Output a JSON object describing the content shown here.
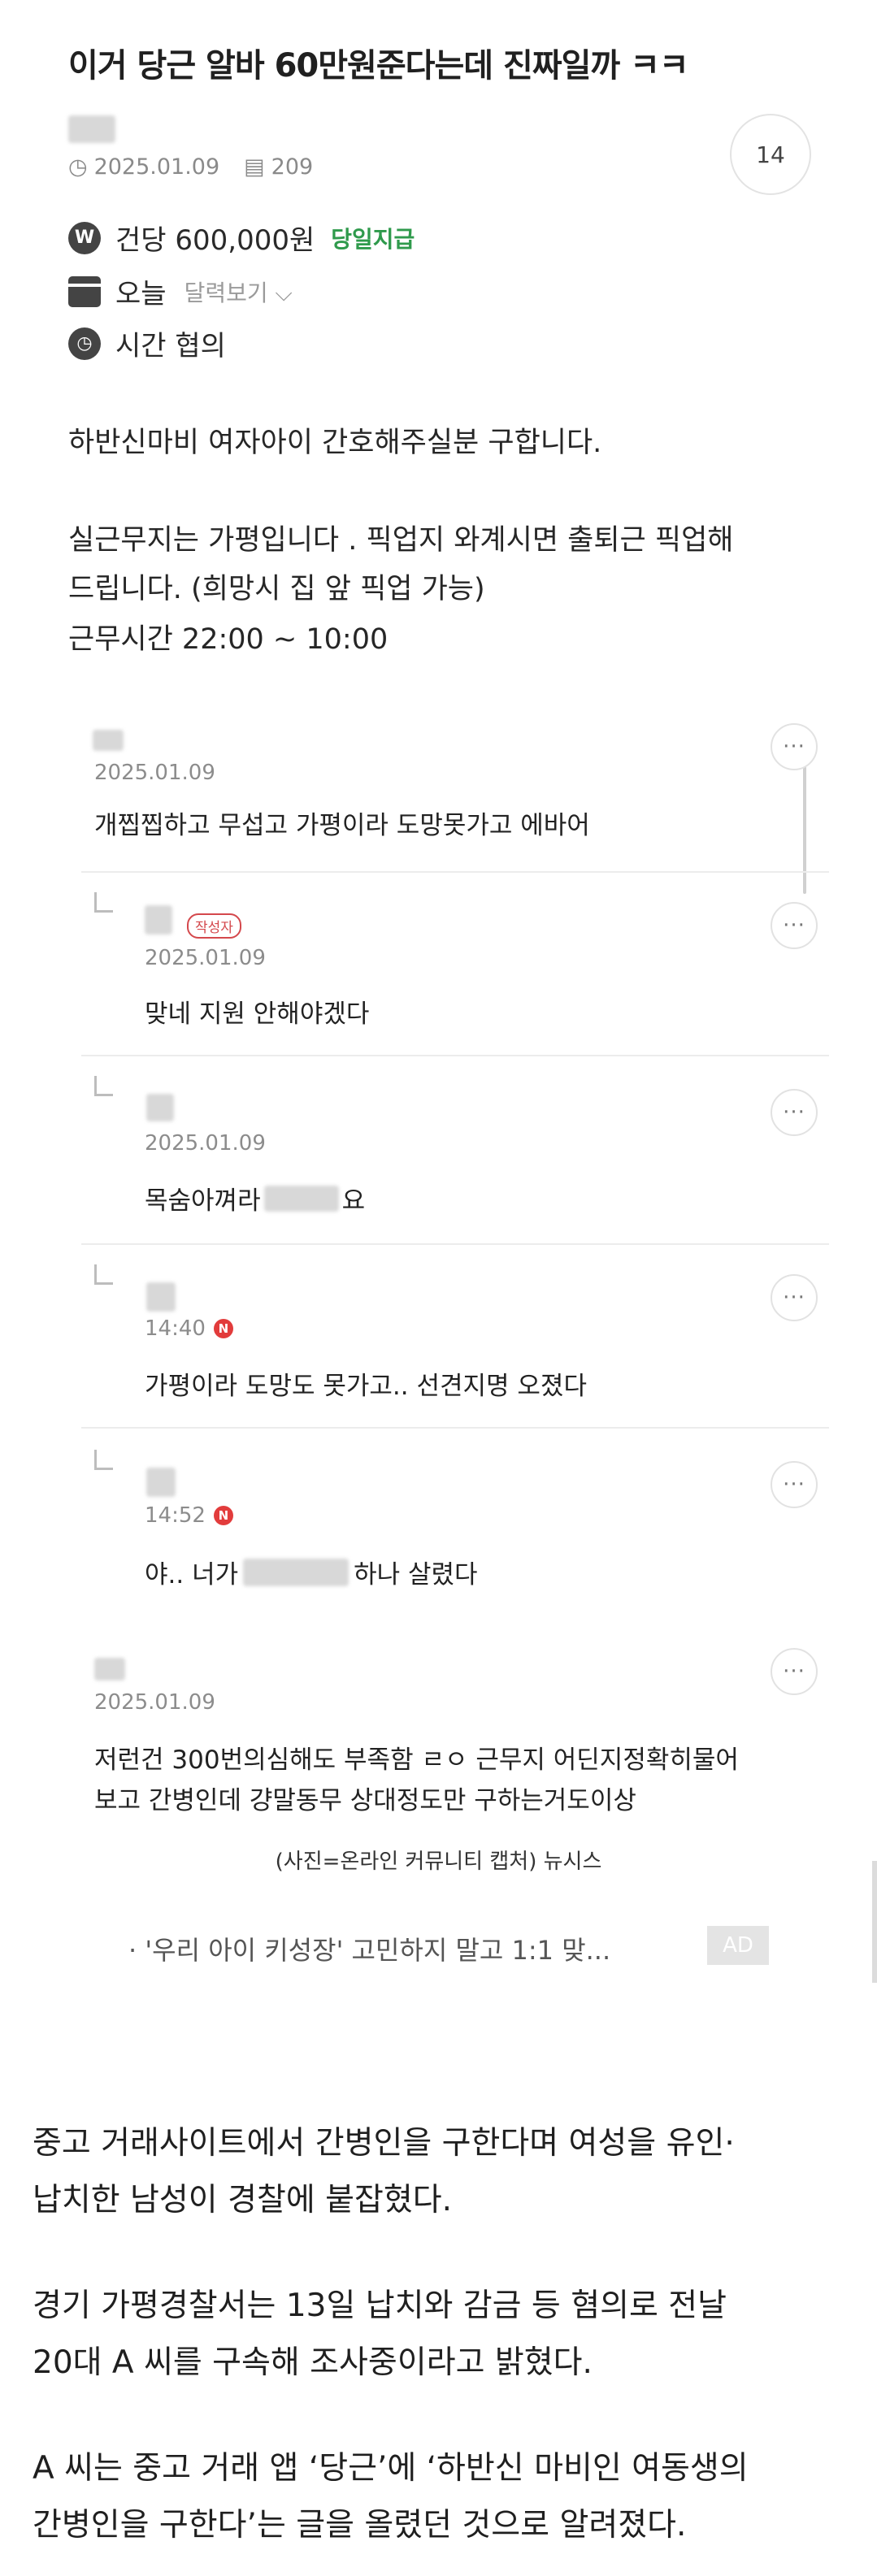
{
  "post": {
    "title": "이거 당근 알바 60만원준다는데 진짜일까 ㅋㅋ",
    "date": "2025.01.09",
    "views": "209",
    "comment_count": "14",
    "pay_icon": "W",
    "pay": "건당 600,000원",
    "pay_badge": "당일지급",
    "day": "오늘",
    "calendar_link": "달력보기",
    "time": "시간 협의",
    "body_lines": [
      "하반신마비 여자아이 간호해주실분 구합니다.",
      "실근무지는 가평입니다 . 픽업지 와계시면 출퇴근 픽업해",
      "드립니다. (희망시 집 앞 픽업 가능)",
      "근무시간 22:00 ~ 10:00"
    ]
  },
  "comments": [
    {
      "date": "2025.01.09",
      "text": "개찝찝하고 무섭고 가평이라 도망못가고 에바어"
    },
    {
      "badge": "작성자",
      "date": "2025.01.09",
      "text": "맞네 지원 안해야겠다"
    },
    {
      "date": "2025.01.09",
      "text_before": "목숨아껴라",
      "text_after": "요"
    },
    {
      "date": "14:40",
      "new_badge": "N",
      "text": "가평이라 도망도 못가고.. 선견지명 오졌다"
    },
    {
      "date": "14:52",
      "new_badge": "N",
      "text_before": "야.. 너가",
      "text_after": "하나 살렸다"
    },
    {
      "date": "2025.01.09",
      "text_line1": "저런건 300번의심해도 부족함 ㄹㅇ 근무지 어딘지정확히물어",
      "text_line2": "보고 간병인데 걍말동무 상대정도만 구하는거도이상"
    }
  ],
  "more_label": "···",
  "caption": "(사진=온라인 커뮤니티 캡처) 뉴시스",
  "related": {
    "link": "· '우리 아이 키성장' 고민하지 말고 1:1 맞...",
    "ad": "AD"
  },
  "article": {
    "lines": [
      "중고 거래사이트에서 간병인을 구한다며 여성을 유인·",
      "납치한 남성이 경찰에 붙잡혔다.",
      "경기 가평경찰서는 13일 납치와 감금 등 혐의로 전날",
      "20대 A 씨를 구속해 조사중이라고 밝혔다.",
      "A 씨는 중고 거래 앱 ‘당근’에 ‘하반신 마비인 여동생의",
      "간병인을 구한다’는 글을 올렸던 것으로 알려졌다."
    ]
  }
}
